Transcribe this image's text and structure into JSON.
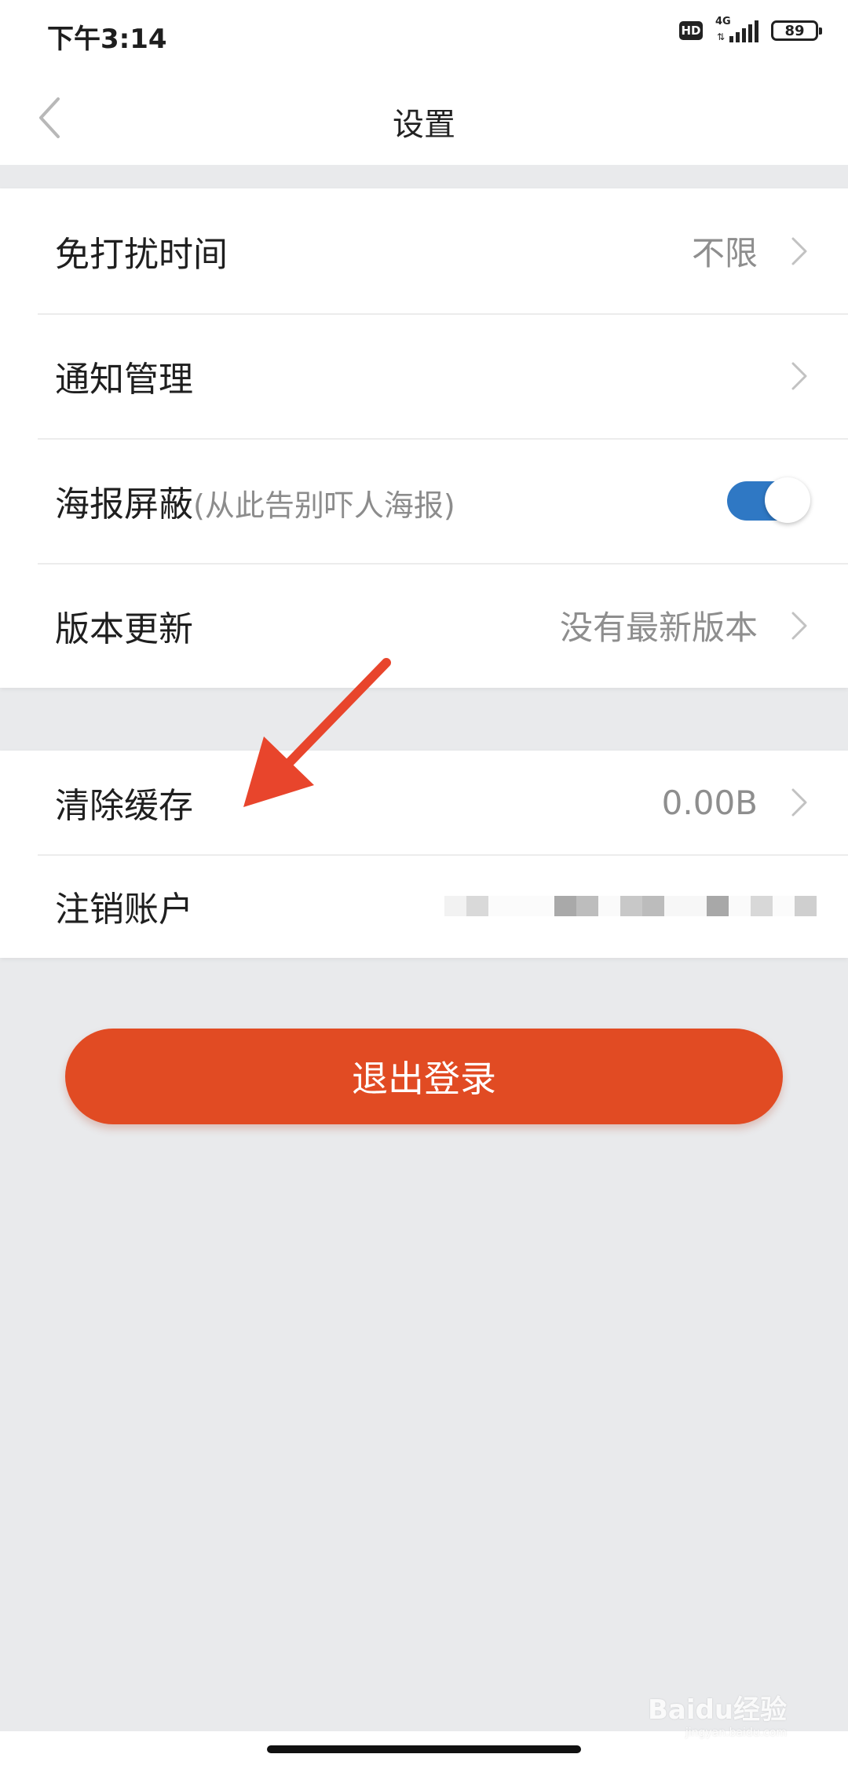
{
  "status_bar": {
    "time": "下午3:14",
    "hd": "HD",
    "network": "4G",
    "battery": "89"
  },
  "nav": {
    "title": "设置",
    "back_icon": "chevron-left-icon"
  },
  "settings_group_1": [
    {
      "label": "免打扰时间",
      "value": "不限"
    },
    {
      "label": "通知管理",
      "value": ""
    },
    {
      "label": "海报屏蔽",
      "hint": "(从此告别吓人海报)",
      "toggle_on": true,
      "toggle_color": "#2f78c4"
    },
    {
      "label": "版本更新",
      "value": "没有最新版本"
    }
  ],
  "settings_group_2": [
    {
      "label": "清除缓存",
      "value": "0.00B"
    },
    {
      "label": "注销账户",
      "value_obscured": true
    }
  ],
  "logout": {
    "label": "退出登录",
    "color": "#e14b23"
  },
  "annotation": {
    "arrow_color": "#e8452c",
    "arrow_icon": "red-arrow-icon"
  },
  "watermark": {
    "text": "Baidu经验",
    "subtext": "jingyan.baidu.com"
  }
}
